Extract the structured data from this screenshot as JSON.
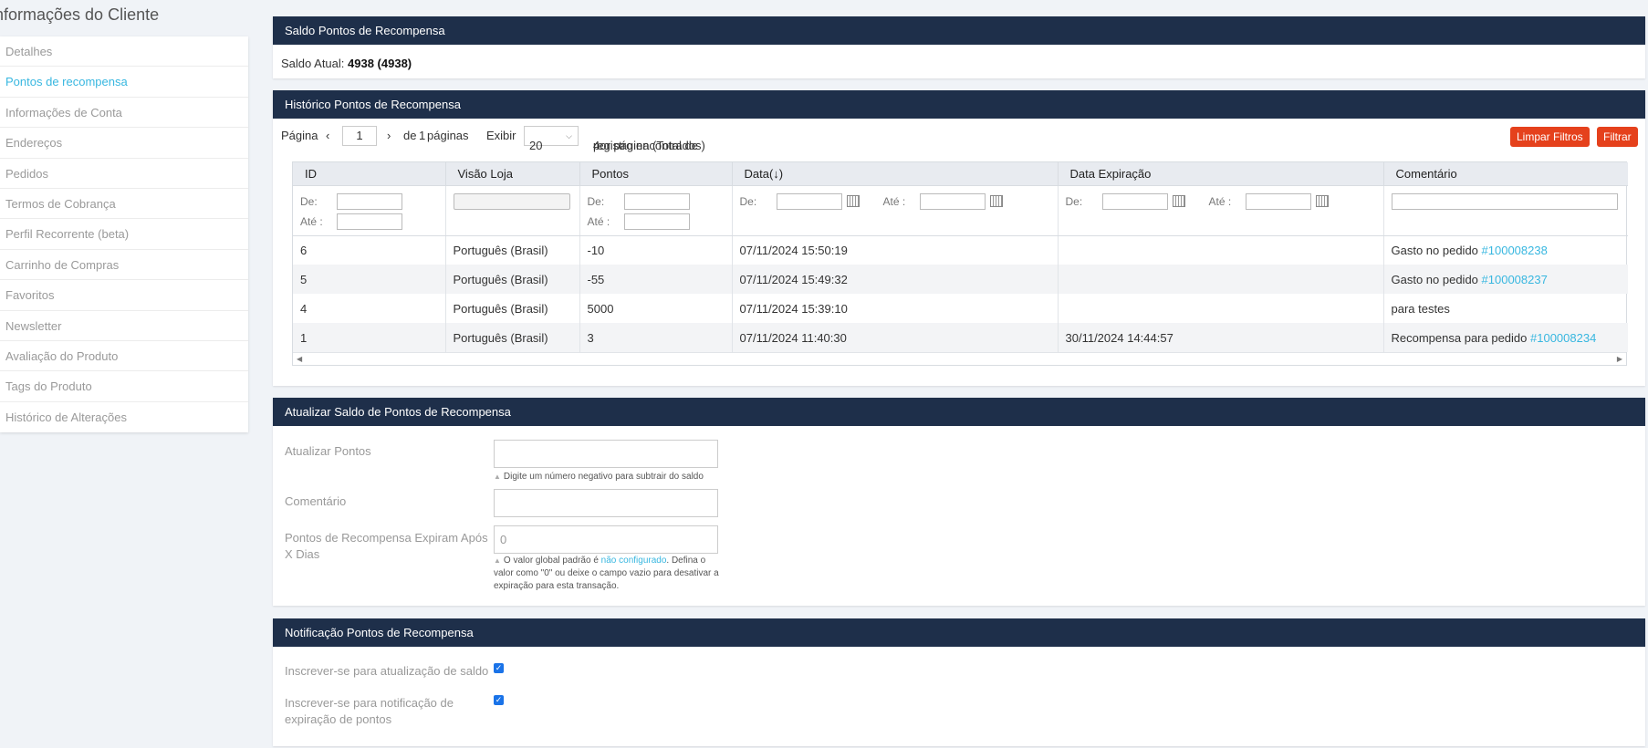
{
  "sidebar": {
    "title": "nformações do Cliente",
    "items": [
      {
        "label": "Detalhes"
      },
      {
        "label": "Pontos de recompensa",
        "active": true
      },
      {
        "label": "Informações de Conta"
      },
      {
        "label": "Endereços"
      },
      {
        "label": "Pedidos"
      },
      {
        "label": "Termos de Cobrança"
      },
      {
        "label": "Perfil Recorrente (beta)"
      },
      {
        "label": "Carrinho de Compras"
      },
      {
        "label": "Favoritos"
      },
      {
        "label": "Newsletter"
      },
      {
        "label": "Avaliação do Produto"
      },
      {
        "label": "Tags do Produto"
      },
      {
        "label": "Histórico de Alterações"
      }
    ]
  },
  "balance": {
    "title": "Saldo Pontos de Recompensa",
    "label": "Saldo Atual:",
    "value": "4938 (4938)"
  },
  "history": {
    "title": "Histórico Pontos de Recompensa",
    "pager": {
      "page_label": "Página",
      "page_value": "1",
      "prev_glyph": "‹",
      "next_glyph": "›",
      "of_label": "de",
      "total_pages": "1",
      "pages_label": "páginas",
      "show_label": "Exibir",
      "per_page": "20",
      "per_page_suffix": "por página (Total de",
      "total_records": "4",
      "records_suffix": "registro encontrados)"
    },
    "clear_filters": "Limpar Filtros",
    "filter": "Filtrar",
    "columns": [
      "ID",
      "Visão Loja",
      "Pontos",
      "Data",
      "Data Expiração",
      "Comentário"
    ],
    "sort_glyph": "(↓)",
    "filter_labels": {
      "from": "De:",
      "to": "Até :"
    },
    "rows": [
      {
        "id": "6",
        "store": "Português (Brasil)",
        "points": "-10",
        "date": "07/11/2024 15:50:19",
        "expire": "",
        "comment": "Gasto no pedido",
        "order": "#100008238"
      },
      {
        "id": "5",
        "store": "Português (Brasil)",
        "points": "-55",
        "date": "07/11/2024 15:49:32",
        "expire": "",
        "comment": "Gasto no pedido",
        "order": "#100008237"
      },
      {
        "id": "4",
        "store": "Português (Brasil)",
        "points": "5000",
        "date": "07/11/2024 15:39:10",
        "expire": "",
        "comment": "para testes",
        "order": ""
      },
      {
        "id": "1",
        "store": "Português (Brasil)",
        "points": "3",
        "date": "07/11/2024 11:40:30",
        "expire": "30/11/2024 14:44:57",
        "comment": "Recompensa para pedido",
        "order": "#100008234"
      }
    ]
  },
  "update": {
    "title": "Atualizar Saldo de Pontos de Recompensa",
    "points_label": "Atualizar Pontos",
    "points_value": "",
    "points_hint": "Digite um número negativo para subtrair do saldo",
    "comment_label": "Comentário",
    "comment_value": "",
    "expire_label": "Pontos de Recompensa Expiram Após X Dias",
    "expire_placeholder": "0",
    "expire_hint_pre": "O valor global padrão é",
    "expire_hint_link": "não configurado",
    "expire_hint_post": ". Defina o valor como \"0\" ou deixe o campo vazio para desativar a expiração para esta transação."
  },
  "notify": {
    "title": "Notificação Pontos de Recompensa",
    "balance_label": "Inscrever-se para atualização de saldo",
    "balance_checked": true,
    "expire_label": "Inscrever-se para notificação de expiração de pontos",
    "expire_checked": true
  }
}
